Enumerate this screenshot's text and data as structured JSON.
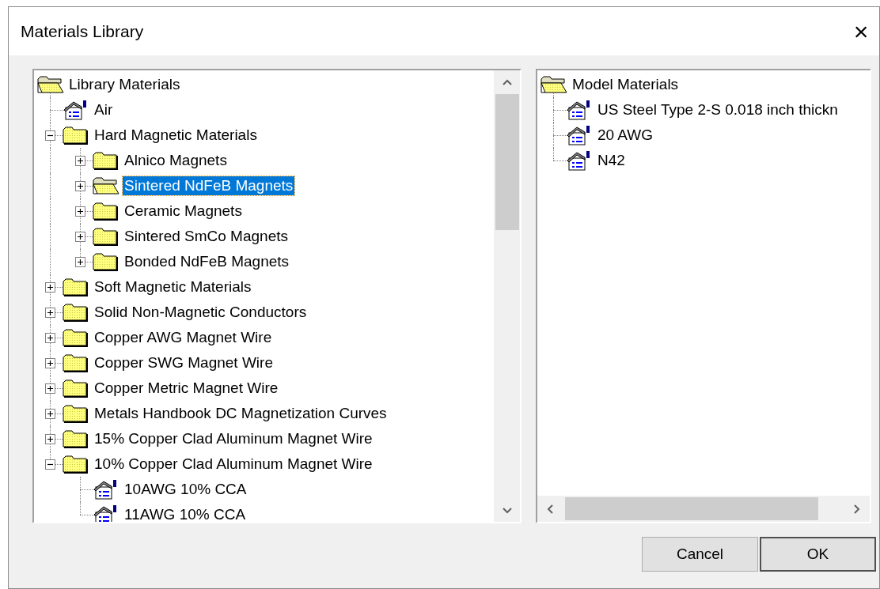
{
  "window": {
    "title": "Materials Library",
    "close": "×"
  },
  "library_tree": {
    "items": [
      {
        "kind": "root",
        "label": "Library Materials",
        "selected": false,
        "children": [
          {
            "kind": "material",
            "label": "Air",
            "selected": false
          },
          {
            "kind": "folder",
            "label": "Hard Magnetic Materials",
            "selected": false,
            "expanded": true,
            "children": [
              {
                "kind": "folder",
                "label": "Alnico Magnets",
                "selected": false,
                "expanded": false
              },
              {
                "kind": "folder",
                "label": "Sintered NdFeB Magnets",
                "selected": true,
                "expanded": false
              },
              {
                "kind": "folder",
                "label": "Ceramic Magnets",
                "selected": false,
                "expanded": false
              },
              {
                "kind": "folder",
                "label": "Sintered SmCo Magnets",
                "selected": false,
                "expanded": false
              },
              {
                "kind": "folder",
                "label": "Bonded NdFeB Magnets",
                "selected": false,
                "expanded": false
              }
            ]
          },
          {
            "kind": "folder",
            "label": "Soft Magnetic Materials",
            "selected": false,
            "expanded": false
          },
          {
            "kind": "folder",
            "label": "Solid Non-Magnetic Conductors",
            "selected": false,
            "expanded": false
          },
          {
            "kind": "folder",
            "label": "Copper AWG Magnet Wire",
            "selected": false,
            "expanded": false
          },
          {
            "kind": "folder",
            "label": "Copper SWG Magnet Wire",
            "selected": false,
            "expanded": false
          },
          {
            "kind": "folder",
            "label": "Copper Metric Magnet Wire",
            "selected": false,
            "expanded": false
          },
          {
            "kind": "folder",
            "label": "Metals Handbook DC Magnetization Curves",
            "selected": false,
            "expanded": false
          },
          {
            "kind": "folder",
            "label": "15% Copper Clad Aluminum Magnet Wire",
            "selected": false,
            "expanded": false
          },
          {
            "kind": "folder",
            "label": "10% Copper Clad Aluminum Magnet Wire",
            "selected": false,
            "expanded": true,
            "children": [
              {
                "kind": "material",
                "label": "10AWG 10% CCA",
                "selected": false
              },
              {
                "kind": "material",
                "label": "11AWG 10% CCA",
                "selected": false
              }
            ]
          }
        ]
      }
    ]
  },
  "model_tree": {
    "items": [
      {
        "kind": "root",
        "label": "Model Materials",
        "selected": false,
        "children": [
          {
            "kind": "material",
            "label": "US Steel Type 2-S 0.018 inch thickn",
            "selected": false
          },
          {
            "kind": "material",
            "label": "20 AWG",
            "selected": false
          },
          {
            "kind": "material",
            "label": "N42",
            "selected": false
          }
        ]
      }
    ]
  },
  "buttons": [
    {
      "label": "Cancel",
      "default": false
    },
    {
      "label": "OK",
      "default": true
    }
  ]
}
